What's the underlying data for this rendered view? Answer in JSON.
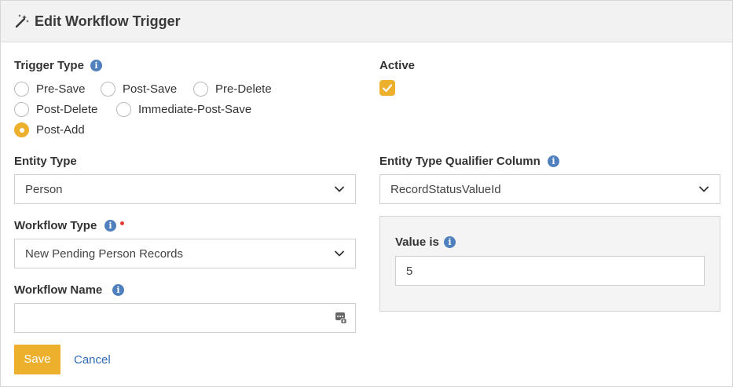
{
  "header": {
    "title": "Edit Workflow Trigger",
    "icon": "magic-wand-icon"
  },
  "trigger_type": {
    "label": "Trigger Type",
    "options": [
      "Pre-Save",
      "Post-Save",
      "Pre-Delete",
      "Post-Delete",
      "Immediate-Post-Save",
      "Post-Add"
    ],
    "selected": "Post-Add"
  },
  "active": {
    "label": "Active",
    "checked": true
  },
  "entity_type": {
    "label": "Entity Type",
    "value": "Person"
  },
  "qualifier_column": {
    "label": "Entity Type Qualifier Column",
    "value": "RecordStatusValueId"
  },
  "workflow_type": {
    "label": "Workflow Type",
    "value": "New Pending Person Records",
    "required": true
  },
  "value_is": {
    "label": "Value is",
    "value": "5"
  },
  "workflow_name": {
    "label": "Workflow Name",
    "value": ""
  },
  "actions": {
    "save": "Save",
    "cancel": "Cancel"
  },
  "colors": {
    "accent": "#edb02c",
    "info": "#4f7fbd",
    "link": "#2f6bb6",
    "required": "#e53935"
  }
}
